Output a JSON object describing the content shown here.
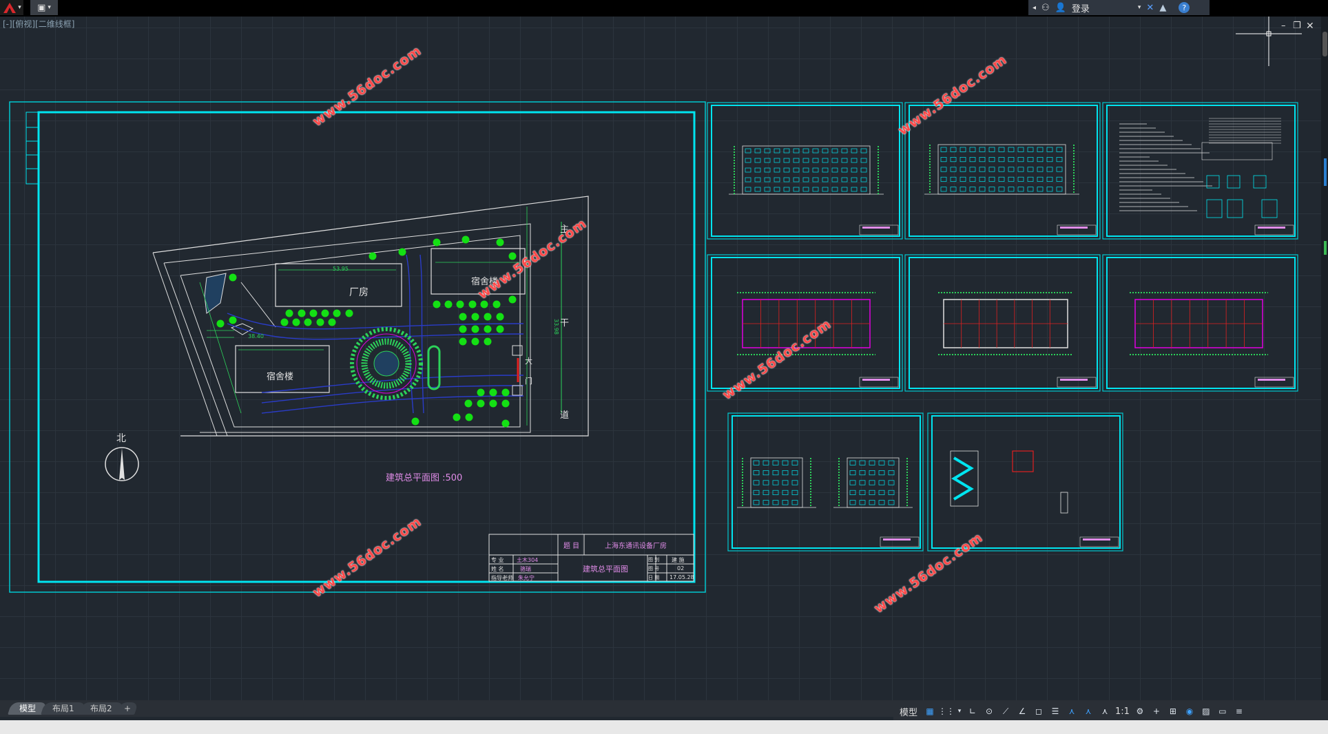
{
  "titlebar": {
    "login_label": "登录"
  },
  "viewport": {
    "view_label": "[-][俯视][二维线框]"
  },
  "watermark": "www.56doc.com",
  "site_plan": {
    "factory_label": "厂房",
    "dorm_label_1": "宿舍楼",
    "dorm_label_2": "宿舍楼",
    "north_label": "北",
    "road_chars": [
      "主",
      "干",
      "道"
    ],
    "gate_char": "大",
    "gate_char2": "门",
    "caption": "建筑总平面图 :500",
    "dim_1": "53.95",
    "dim_2": "38.40",
    "dim_3": "33.98"
  },
  "title_block": {
    "title_heading": "题 目",
    "project_name": "上海东通讯设备厂房",
    "drawing_name": "建筑总平面图",
    "row1": [
      "专 业",
      "土木304"
    ],
    "row2": [
      "姓 名",
      "骆瑞"
    ],
    "row3": [
      "指导老师",
      "朱允宁"
    ],
    "col_labels": [
      "图 别",
      "图 号",
      "日 期"
    ],
    "col_values": [
      "建 施",
      "02",
      "17.05.28"
    ]
  },
  "tabs": {
    "model": "模型",
    "layout1": "布局1",
    "layout2": "布局2",
    "add": "+"
  },
  "statusbar": {
    "model_label": "模型",
    "scale_label": "1:1"
  }
}
